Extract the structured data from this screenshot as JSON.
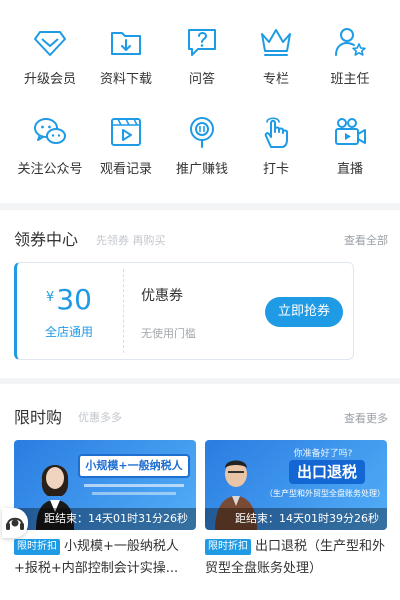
{
  "theme": {
    "accent": "#1f9be6"
  },
  "grid": {
    "items": [
      {
        "icon": "diamond-icon",
        "label": "升级会员"
      },
      {
        "icon": "folder-download-icon",
        "label": "资料下载"
      },
      {
        "icon": "question-chat-icon",
        "label": "问答"
      },
      {
        "icon": "crown-icon",
        "label": "专栏"
      },
      {
        "icon": "user-star-icon",
        "label": "班主任"
      },
      {
        "icon": "wechat-icon",
        "label": "关注公众号"
      },
      {
        "icon": "video-play-icon",
        "label": "观看记录"
      },
      {
        "icon": "coin-icon",
        "label": "推广赚钱"
      },
      {
        "icon": "hand-tap-icon",
        "label": "打卡"
      },
      {
        "icon": "camera-icon",
        "label": "直播"
      }
    ]
  },
  "coupons": {
    "title": "领券中心",
    "subtitle": "先领券 再购买",
    "more": "查看全部",
    "card": {
      "currency": "¥",
      "amount": "30",
      "scope": "全店通用",
      "name": "优惠券",
      "desc": "无使用门槛",
      "button": "立即抢券"
    }
  },
  "flash": {
    "title": "限时购",
    "subtitle": "优惠多多",
    "more": "查看更多",
    "courses": [
      {
        "banner_text": "小规模+一般纳税人",
        "countdown": "距结束：14天01时31分26秒",
        "badge": "限时折扣",
        "title": "小规模+一般纳税人+报税+内部控制会计实操..."
      },
      {
        "banner_top": "你准备好了吗?",
        "banner_main": "出口退税",
        "banner_sub": "（生产型和外贸型全盘账务处理）",
        "countdown": "距结束：14天01时39分26秒",
        "badge": "限时折扣",
        "title": "出口退税（生产型和外贸型全盘账务处理）"
      }
    ]
  }
}
